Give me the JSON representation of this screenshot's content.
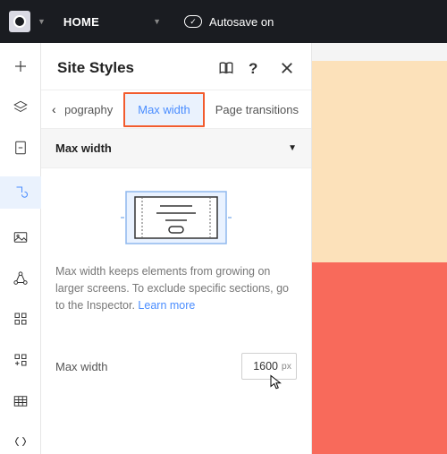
{
  "topbar": {
    "home_label": "HOME",
    "autosave_label": "Autosave on"
  },
  "panel": {
    "title": "Site Styles"
  },
  "tabs": {
    "prev": "pography",
    "active": "Max width",
    "next": "Page transitions"
  },
  "section": {
    "title": "Max width"
  },
  "body": {
    "desc_prefix": "Max width keeps elements from growing on larger screens. To exclude specific sections, go to the Inspector. ",
    "learn_more": "Learn more"
  },
  "row": {
    "label": "Max width",
    "value": "1600",
    "unit": "px"
  }
}
